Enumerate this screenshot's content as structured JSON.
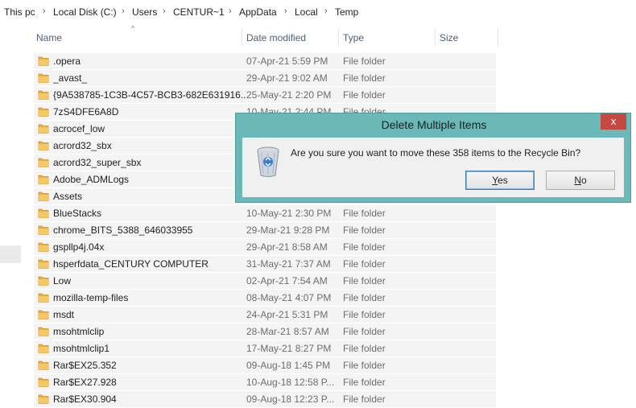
{
  "breadcrumb": [
    "This pc",
    "Local Disk (C:)",
    "Users",
    "CENTUR~1",
    "AppData",
    "Local",
    "Temp"
  ],
  "columns": {
    "name": "Name",
    "date": "Date modified",
    "type": "Type",
    "size": "Size"
  },
  "rows": [
    {
      "name": ".opera",
      "date": "07-Apr-21 5:59 PM",
      "type": "File folder"
    },
    {
      "name": "_avast_",
      "date": "29-Apr-21 9:02 AM",
      "type": "File folder"
    },
    {
      "name": "{9A538785-1C3B-4C57-BCB3-682E631916...",
      "date": "25-May-21 2:20 PM",
      "type": "File folder"
    },
    {
      "name": "7zS4DFE6A8D",
      "date": "10-May-21 2:44 PM",
      "type": "File folder"
    },
    {
      "name": "acrocef_low",
      "date": "",
      "type": ""
    },
    {
      "name": "acrord32_sbx",
      "date": "",
      "type": ""
    },
    {
      "name": "acrord32_super_sbx",
      "date": "",
      "type": ""
    },
    {
      "name": "Adobe_ADMLogs",
      "date": "",
      "type": ""
    },
    {
      "name": "Assets",
      "date": "",
      "type": ""
    },
    {
      "name": "BlueStacks",
      "date": "10-May-21 2:30 PM",
      "type": "File folder"
    },
    {
      "name": "chrome_BITS_5388_646033955",
      "date": "29-Mar-21 9:28 PM",
      "type": "File folder"
    },
    {
      "name": "gspllp4j.04x",
      "date": "29-Apr-21 8:58 AM",
      "type": "File folder"
    },
    {
      "name": "hsperfdata_CENTURY COMPUTER",
      "date": "31-May-21 7:37 AM",
      "type": "File folder"
    },
    {
      "name": "Low",
      "date": "02-Apr-21 7:54 AM",
      "type": "File folder"
    },
    {
      "name": "mozilla-temp-files",
      "date": "08-May-21 4:07 PM",
      "type": "File folder"
    },
    {
      "name": "msdt",
      "date": "24-Apr-21 5:31 PM",
      "type": "File folder"
    },
    {
      "name": "msohtmlclip",
      "date": "28-Mar-21 8:57 AM",
      "type": "File folder"
    },
    {
      "name": "msohtmlclip1",
      "date": "17-May-21 8:27 PM",
      "type": "File folder"
    },
    {
      "name": "Rar$EX25.352",
      "date": "09-Aug-18 1:45 PM",
      "type": "File folder"
    },
    {
      "name": "Rar$EX27.928",
      "date": "10-Aug-18 12:58 P...",
      "type": "File folder"
    },
    {
      "name": "Rar$EX30.904",
      "date": "09-Aug-18 12:23 P...",
      "type": "File folder"
    }
  ],
  "dialog": {
    "title": "Delete Multiple Items",
    "close": "x",
    "message": "Are you sure you want to move these 358 items to the Recycle Bin?",
    "yes_mnemonic": "Y",
    "yes_rest": "es",
    "no_mnemonic": "N",
    "no_rest": "o"
  },
  "colors": {
    "dialog_frame": "#6bb8b8",
    "close_button": "#c7483f",
    "folder": "#e8b13d"
  }
}
